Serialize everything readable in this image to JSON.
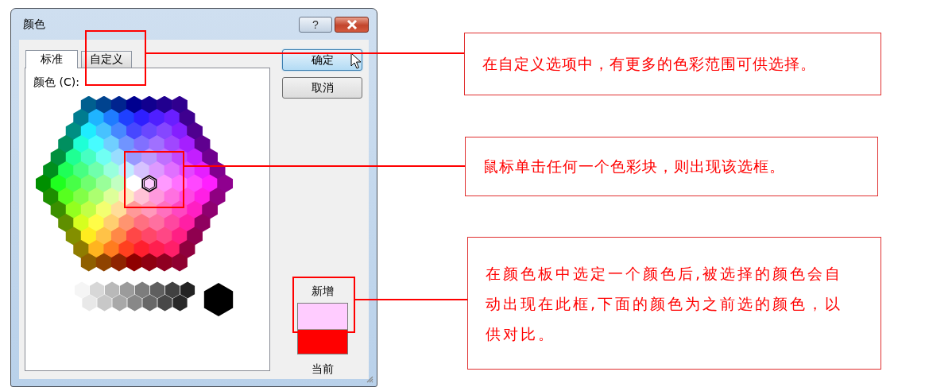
{
  "window": {
    "title": "颜色",
    "title_buttons": [
      {
        "kind": "help",
        "label": "?"
      },
      {
        "kind": "close"
      }
    ]
  },
  "tabs": [
    {
      "label": "标准",
      "selected": true
    },
    {
      "label": "自定义",
      "selected": false
    }
  ],
  "colors_label": "颜色 (C):",
  "buttons": [
    {
      "label": "确定",
      "highlighted": true
    },
    {
      "label": "取消",
      "highlighted": false
    }
  ],
  "preview": {
    "new_label": "新增",
    "swatches": [
      {
        "kind": "new",
        "color": "#ffccff"
      },
      {
        "kind": "current",
        "color": "#ff0000"
      }
    ],
    "current_label": "当前"
  },
  "annotations": [
    {
      "text": "在自定义选项中，有更多的色彩范围可供选择。"
    },
    {
      "text": "鼠标单击任何一个色彩块，则出现该选框。"
    },
    {
      "text": "在颜色板中选定一个颜色后,被选择的颜色会自动出现在此框,下面的颜色为之前选的颜色，以供对比。"
    }
  ]
}
